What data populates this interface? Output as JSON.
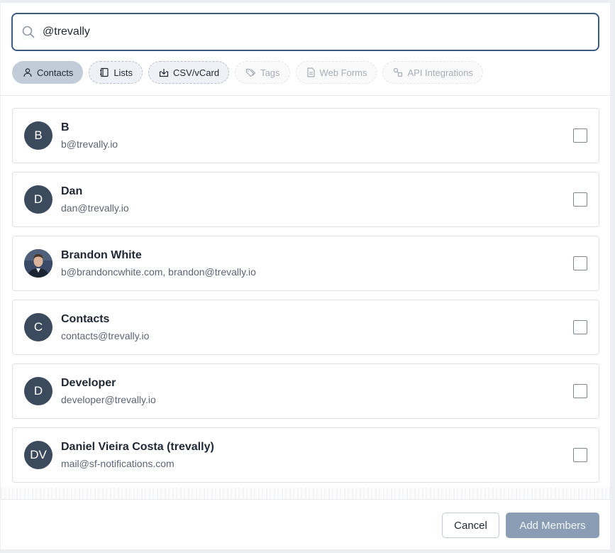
{
  "search": {
    "value": "@trevally",
    "placeholder": ""
  },
  "chips": [
    {
      "label": "Contacts",
      "icon": "person-icon",
      "state": "active"
    },
    {
      "label": "Lists",
      "icon": "notebook-icon",
      "state": "normal"
    },
    {
      "label": "CSV/vCard",
      "icon": "import-icon",
      "state": "normal"
    },
    {
      "label": "Tags",
      "icon": "tag-icon",
      "state": "disabled"
    },
    {
      "label": "Web Forms",
      "icon": "document-icon",
      "state": "disabled"
    },
    {
      "label": "API Integrations",
      "icon": "integration-icon",
      "state": "disabled"
    }
  ],
  "contacts": [
    {
      "initials": "B",
      "name": "B",
      "email": "b@trevally.io",
      "checked": false
    },
    {
      "initials": "D",
      "name": "Dan",
      "email": "dan@trevally.io",
      "checked": false
    },
    {
      "initials": "",
      "name": "Brandon White",
      "email": "b@brandoncwhite.com, brandon@trevally.io",
      "checked": false,
      "photo": true
    },
    {
      "initials": "C",
      "name": "Contacts",
      "email": "contacts@trevally.io",
      "checked": false
    },
    {
      "initials": "D",
      "name": "Developer",
      "email": "developer@trevally.io",
      "checked": false
    },
    {
      "initials": "DV",
      "name": "Daniel Vieira Costa (trevally)",
      "email": "mail@sf-notifications.com",
      "checked": false
    }
  ],
  "footer": {
    "cancel_label": "Cancel",
    "add_label": "Add Members"
  },
  "colors": {
    "accent": "#3d5a80",
    "avatar_bg": "#3c4a5d",
    "add_button_bg": "#8a9db4",
    "active_chip_bg": "#c2ccd8"
  }
}
